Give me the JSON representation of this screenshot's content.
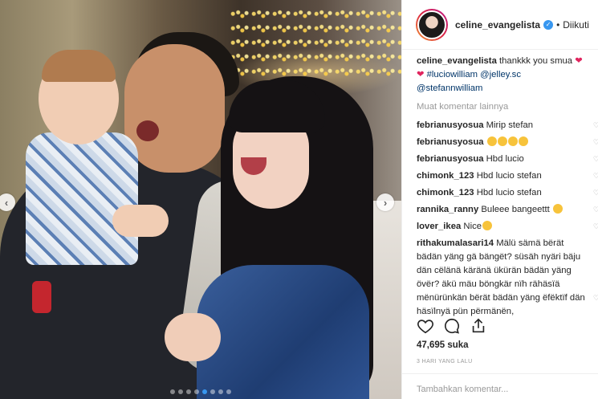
{
  "post": {
    "photo_alt": "",
    "carousel": {
      "dots": 8,
      "active_index": 4
    }
  },
  "header": {
    "username": "celine_evangelista",
    "separator": "•",
    "follow_status": "Diikuti"
  },
  "caption": {
    "username": "celine_evangelista",
    "text": "thankkk you smua",
    "tags": [
      "#luciowilliam",
      "@jelley.sc",
      "@stefannwilliam"
    ]
  },
  "load_more": "Muat komentar lainnya",
  "comments": [
    {
      "user": "febrianusyosua",
      "text": "Mirip stefan"
    },
    {
      "user": "febrianusyosua",
      "text": ""
    },
    {
      "user": "febrianusyosua",
      "text": "Hbd lucio"
    },
    {
      "user": "chimonk_123",
      "text": "Hbd lucio stefan"
    },
    {
      "user": "chimonk_123",
      "text": "Hbd lucio stefan"
    },
    {
      "user": "rannika_ranny",
      "text": "Buleee bangeettt"
    },
    {
      "user": "lover_ikea",
      "text": "Nice"
    },
    {
      "user": "rithakumalasari14",
      "text": "Mälü sämä bërät bädän yäng gä bängët? süsäh nyäri bäju dän cëlänä käränä ükürän bädän yäng övër? äkü mäu böngkär nïh rähäsïä mënürünkän bërät bädän yäng ëfëktïf dän häsïlnyä pün përmänën,"
    }
  ],
  "likes": "47,695 suka",
  "time_ago": "3 HARI YANG LALU",
  "add_comment_placeholder": "Tambahkan komentar...",
  "colors": {
    "link": "#003569",
    "accent": "#3897f0",
    "muted": "#999999"
  }
}
